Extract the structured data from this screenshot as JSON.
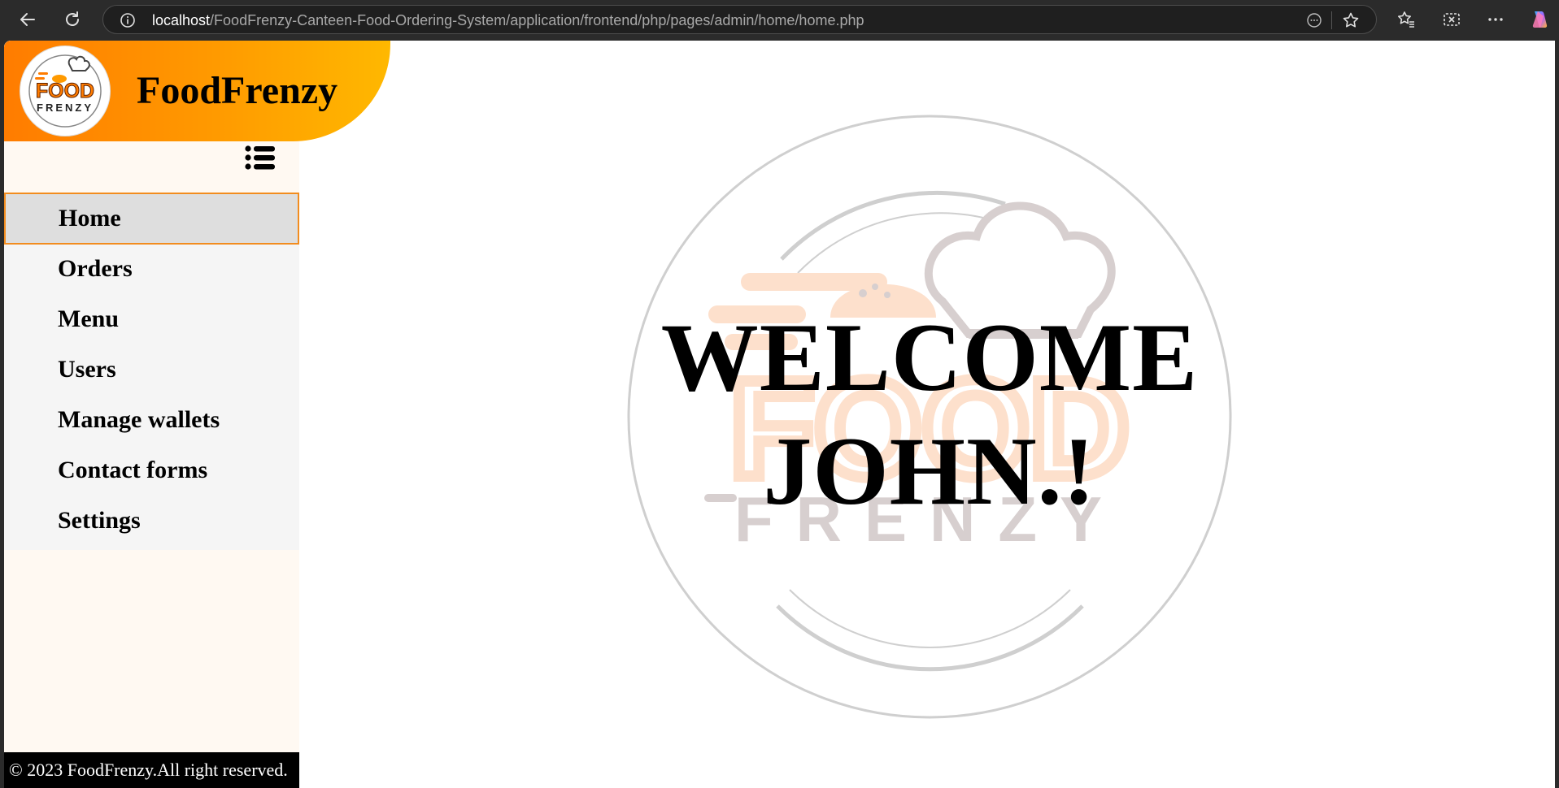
{
  "browser": {
    "url_host": "localhost",
    "url_path": "/FoodFrenzy-Canteen-Food-Ordering-System/application/frontend/php/pages/admin/home/home.php",
    "icons": [
      "back-icon",
      "refresh-icon",
      "info-icon",
      "reader-icon",
      "star-icon",
      "favorites-icon",
      "screenshot-icon",
      "more-icon",
      "copilot-icon"
    ]
  },
  "brand": {
    "name": "FoodFrenzy",
    "logo_text_top": "FOOD",
    "logo_text_bottom": "FRENZY",
    "gradient": [
      "#ff7c00",
      "#ffb800"
    ]
  },
  "sidebar": {
    "toggle_icon": "list-icon",
    "items": [
      {
        "label": "Home",
        "active": true
      },
      {
        "label": "Orders",
        "active": false
      },
      {
        "label": "Menu",
        "active": false
      },
      {
        "label": "Users",
        "active": false
      },
      {
        "label": "Manage wallets",
        "active": false
      },
      {
        "label": "Contact forms",
        "active": false
      },
      {
        "label": "Settings",
        "active": false
      }
    ],
    "footer": "© 2023 FoodFrenzy.All right reserved."
  },
  "main": {
    "welcome_line1": "WELCOME",
    "welcome_line2": "JOHN.!",
    "watermark_text_top": "FOOD",
    "watermark_text_bottom": "FRENZY"
  },
  "colors": {
    "accent": "#f28c1e",
    "active_bg": "#dedede",
    "sidebar_bg": "#fff9f2",
    "menu_bg": "#f5f5f5"
  }
}
